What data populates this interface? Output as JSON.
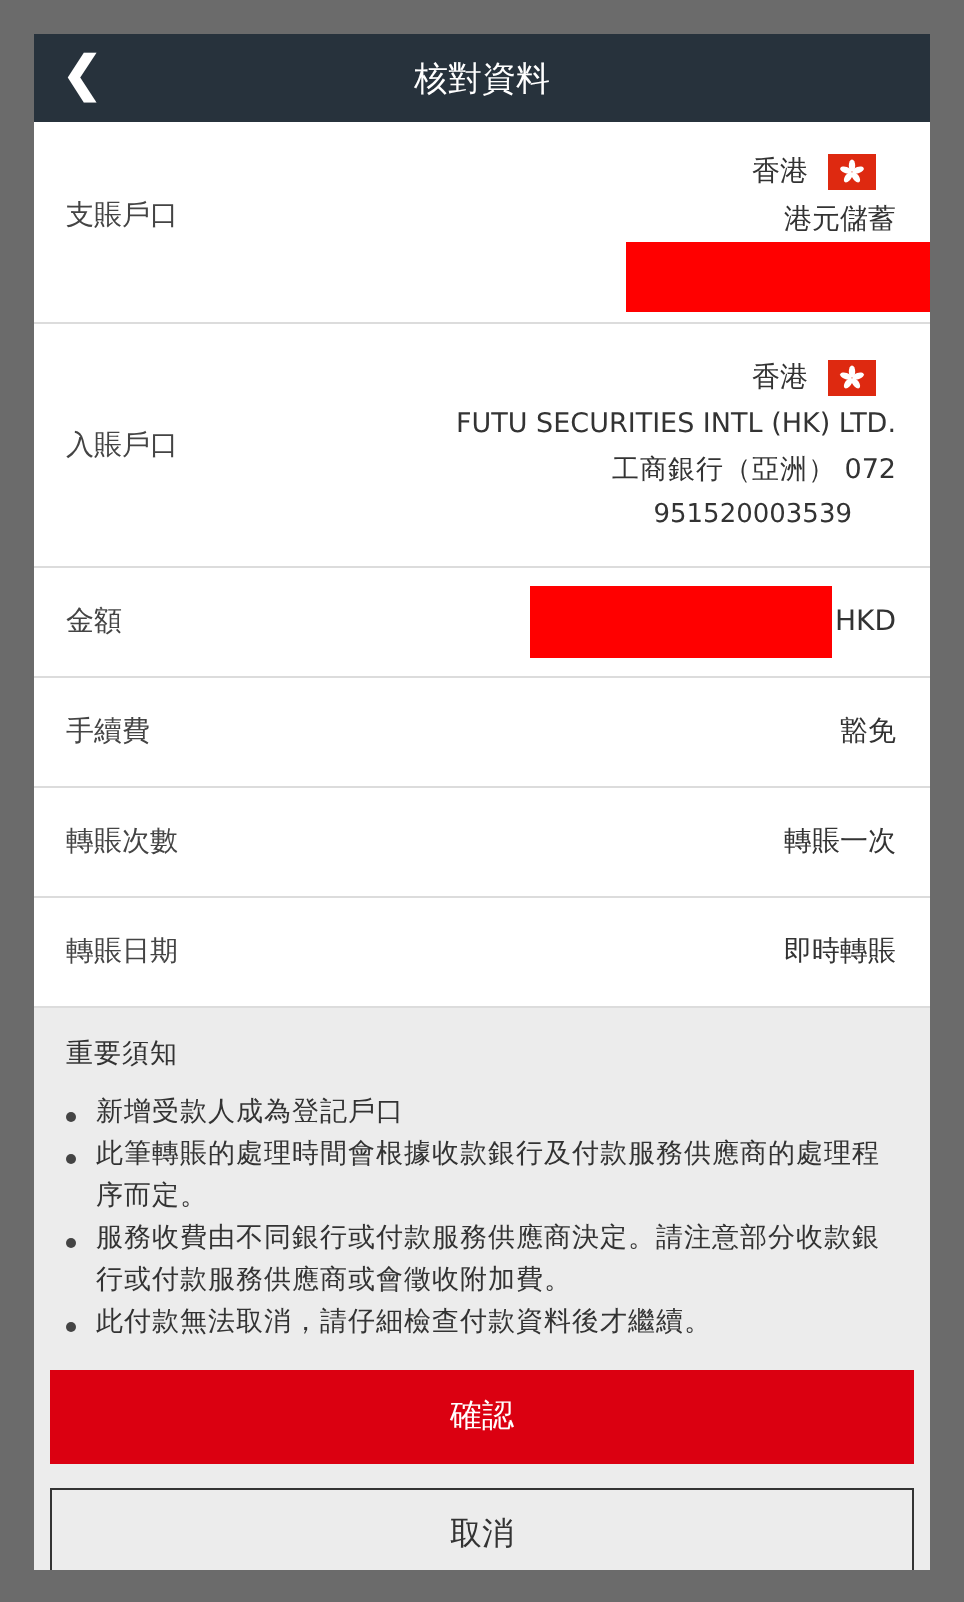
{
  "header": {
    "back": "❮",
    "title": "核對資料"
  },
  "debit_account": {
    "label": "支賬戶口",
    "region": "香港",
    "account_type": "港元儲蓄"
  },
  "credit_account": {
    "label": "入賬戶口",
    "region": "香港",
    "name": "FUTU SECURITIES INTL (HK) LTD.",
    "bank": "工商銀行（亞洲） 072",
    "account_number": "951520003539"
  },
  "rows": [
    {
      "kind": "amount",
      "label": "金額",
      "value": "HKD"
    },
    {
      "kind": "text",
      "label": "手續費",
      "value": "豁免"
    },
    {
      "kind": "text",
      "label": "轉賬次數",
      "value": "轉賬一次"
    },
    {
      "kind": "text",
      "label": "轉賬日期",
      "value": "即時轉賬"
    }
  ],
  "notice": {
    "title": "重要須知",
    "items": [
      "新增受款人成為登記戶口",
      "此筆轉賬的處理時間會根據收款銀行及付款服務供應商的處理程序而定。",
      "服務收費由不同銀行或付款服務供應商決定。請注意部分收款銀行或付款服務供應商或會徵收附加費。",
      "此付款無法取消，請仔細檢查付款資料後才繼續。"
    ]
  },
  "buttons": {
    "confirm": "確認",
    "cancel": "取消"
  }
}
